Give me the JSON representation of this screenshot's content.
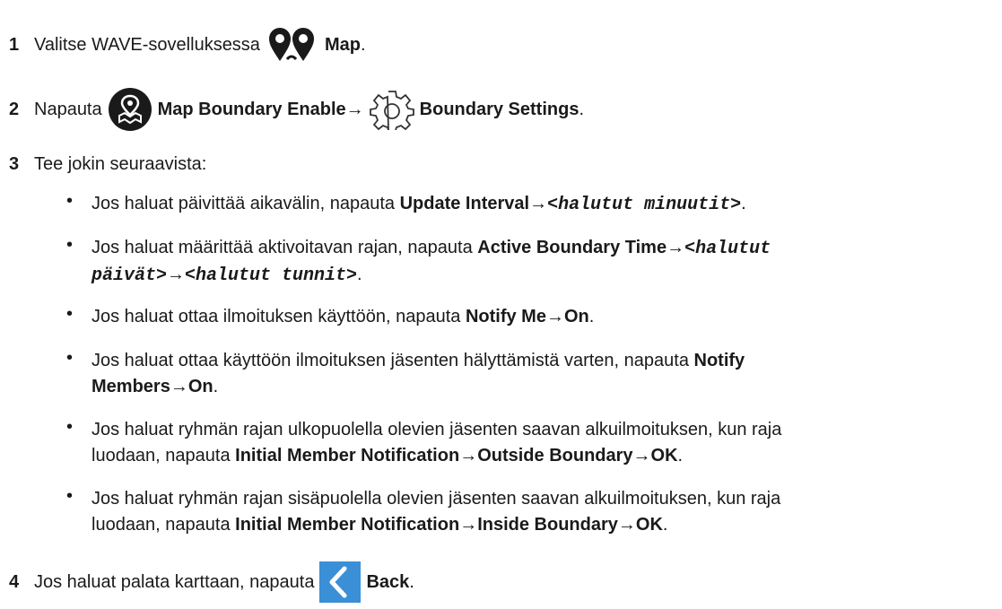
{
  "steps": [
    {
      "num": "1",
      "pre": "Valitse WAVE-sovelluksessa",
      "icon": "map-pins-icon",
      "bold": "Map",
      "post": "."
    },
    {
      "num": "2",
      "pre": "Napauta",
      "icon1": "map-boundary-icon",
      "bold1": "Map Boundary Enable",
      "arrow": "→",
      "icon2": "gear-icon",
      "bold2": "Boundary Settings",
      "post": "."
    },
    {
      "num": "3",
      "text": "Tee jokin seuraavista:"
    },
    {
      "num": "4",
      "pre": "Jos haluat palata karttaan, napauta",
      "icon": "back-chevron-icon",
      "bold": "Back",
      "post": "."
    }
  ],
  "bullets": [
    {
      "pre": "Jos haluat päivittää aikavälin, napauta ",
      "b1": "Update Interval",
      "arrow1": "→",
      "m1": "<halutut minuutit>",
      "post": "."
    },
    {
      "pre": "Jos haluat määrittää aktivoitavan rajan, napauta ",
      "b1": "Active Boundary Time",
      "arrow1": "→",
      "m1": "<halutut",
      "m2": "päivät>",
      "arrow2": "→",
      "m3": "<halutut tunnit>",
      "post": "."
    },
    {
      "pre": "Jos haluat ottaa ilmoituksen käyttöön, napauta ",
      "b1": "Notify Me",
      "arrow1": "→",
      "b2": "On",
      "post": "."
    },
    {
      "pre": "Jos haluat ottaa käyttöön ilmoituksen jäsenten hälyttämistä varten, napauta ",
      "b1": "Notify",
      "b1b": "Members",
      "arrow1": "→",
      "b2": "On",
      "post": "."
    },
    {
      "pre": "Jos haluat ryhmän rajan ulkopuolella olevien jäsenten saavan alkuilmoituksen, kun raja",
      "pre2": "luodaan, napauta ",
      "b1": "Initial Member Notification",
      "arrow1": "→",
      "b2": "Outside Boundary",
      "arrow2": "→",
      "b3": "OK",
      "post": "."
    },
    {
      "pre": "Jos haluat ryhmän rajan sisäpuolella olevien jäsenten saavan alkuilmoituksen, kun raja",
      "pre2": "luodaan, napauta ",
      "b1": "Initial Member Notification",
      "arrow1": "→",
      "b2": "Inside Boundary",
      "arrow2": "→",
      "b3": "OK",
      "post": "."
    }
  ],
  "bullet_char": "•",
  "colors": {
    "text": "#1a1a1a",
    "back_blue": "#3a8fd6",
    "icon_dark": "#1a1a1a"
  }
}
